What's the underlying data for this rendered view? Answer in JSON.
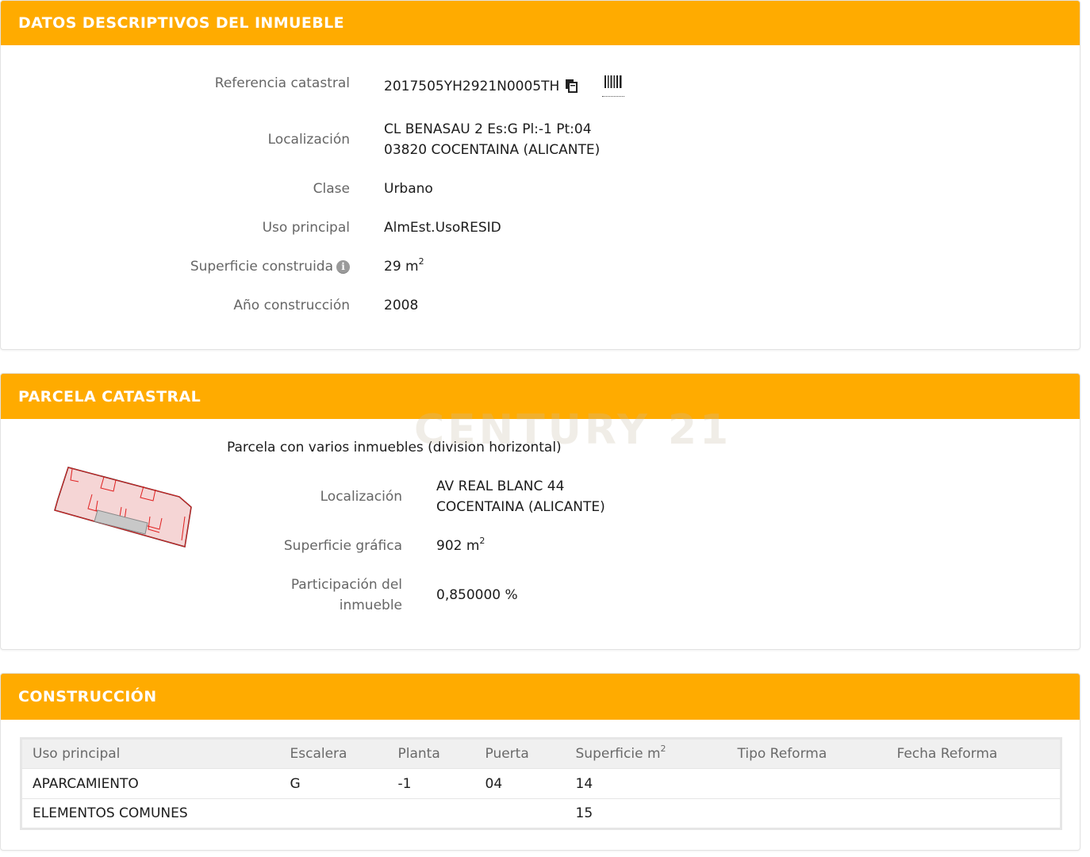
{
  "inmueble": {
    "title": "DATOS DESCRIPTIVOS DEL INMUEBLE",
    "ref_label": "Referencia catastral",
    "ref_value": "2017505YH2921N0005TH",
    "loc_label": "Localización",
    "loc_line1": "CL BENASAU 2 Es:G Pl:-1 Pt:04",
    "loc_line2": "03820 COCENTAINA (ALICANTE)",
    "clase_label": "Clase",
    "clase_value": "Urbano",
    "uso_label": "Uso principal",
    "uso_value": "AlmEst.UsoRESID",
    "sup_label": "Superficie construida",
    "sup_value": "29 m",
    "sup_unit_exp": "2",
    "ano_label": "Año construcción",
    "ano_value": "2008"
  },
  "parcela": {
    "title": "PARCELA CATASTRAL",
    "subtitle": "Parcela con varios inmuebles (division horizontal)",
    "loc_label": "Localización",
    "loc_line1": "AV REAL BLANC 44",
    "loc_line2": "COCENTAINA (ALICANTE)",
    "sup_label": "Superficie gráfica",
    "sup_value": "902 m",
    "sup_unit_exp": "2",
    "part_label_line1": "Participación del",
    "part_label_line2": "inmueble",
    "part_value": "0,850000 %"
  },
  "watermark": "CENTURY 21",
  "construccion": {
    "title": "CONSTRUCCIÓN",
    "headers": [
      "Uso principal",
      "Escalera",
      "Planta",
      "Puerta",
      "Superficie m",
      "Tipo Reforma",
      "Fecha Reforma"
    ],
    "header_sup_exp": "2",
    "rows": [
      [
        "APARCAMIENTO",
        "G",
        "-1",
        "04",
        "14",
        "",
        ""
      ],
      [
        "ELEMENTOS COMUNES",
        "",
        "",
        "",
        "15",
        "",
        ""
      ]
    ]
  },
  "colors": {
    "header_bg": "#ffab00",
    "header_text": "#ffffff",
    "label_text": "#666666",
    "value_text": "#1c1c1c"
  },
  "icons": [
    "copy-icon",
    "barcode-icon",
    "info-icon"
  ]
}
